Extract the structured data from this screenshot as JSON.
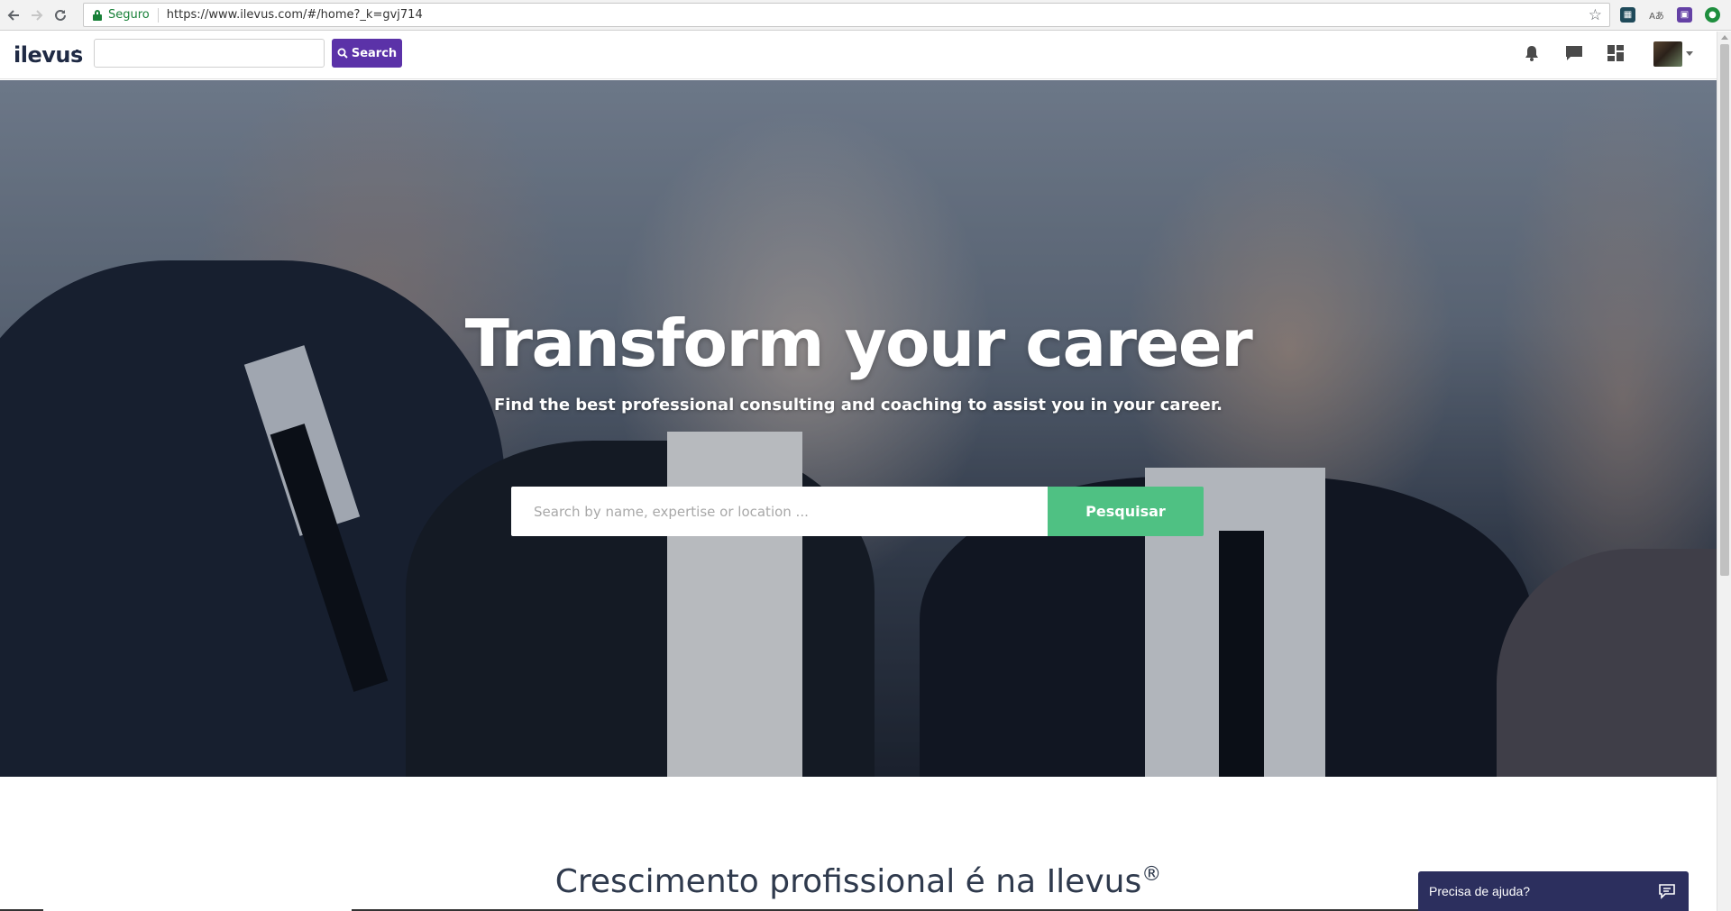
{
  "browser": {
    "secure_label": "Seguro",
    "url": "https://www.ilevus.com/#/home?_k=gvj714"
  },
  "header": {
    "logo": "ilevus",
    "search_placeholder": "",
    "search_button": "Search"
  },
  "hero": {
    "title": "Transform your career",
    "subtitle": "Find the best professional consulting and coaching to assist you in your career.",
    "search_placeholder": "Search by name, expertise or location ...",
    "search_button": "Pesquisar"
  },
  "section": {
    "title": "Crescimento profissional é na Ilevus",
    "trademark": "®"
  },
  "help_widget": {
    "label": "Precisa de ajuda?"
  },
  "colors": {
    "brand_purple": "#5b32a8",
    "accent_green": "#4fc183",
    "help_navy": "#2c2f5e"
  },
  "icons": [
    "back-icon",
    "forward-icon",
    "reload-icon",
    "lock-icon",
    "star-icon",
    "bell-icon",
    "chat-icon",
    "dashboard-icon",
    "chat-bubble-icon"
  ]
}
